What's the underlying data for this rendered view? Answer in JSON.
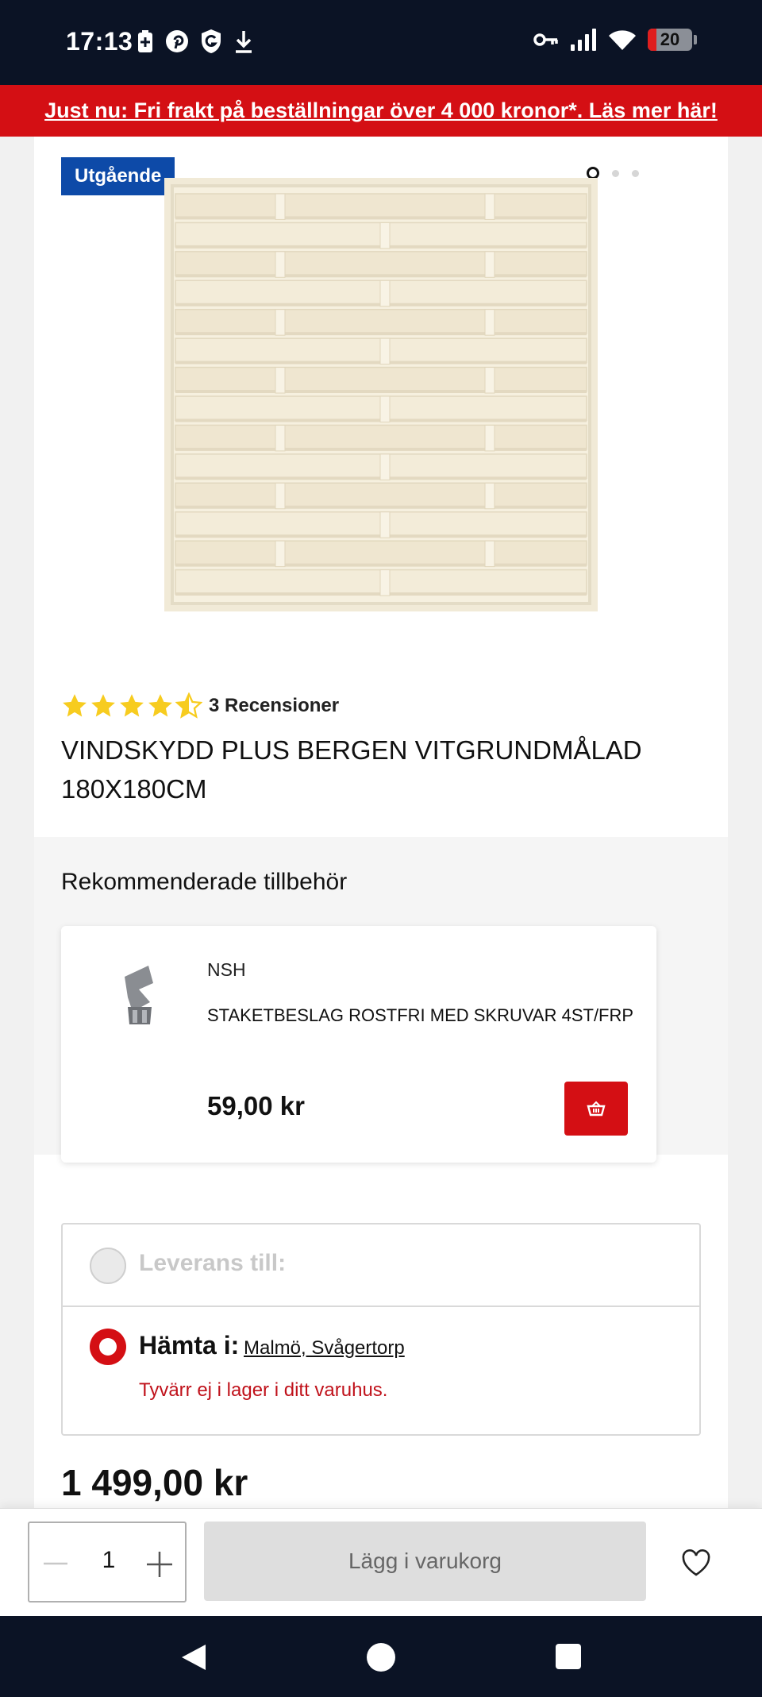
{
  "status_bar": {
    "time": "17:13",
    "left_icons": [
      "battery-saver-icon",
      "pinterest-icon",
      "g-shield-icon",
      "download-icon"
    ],
    "right_icons": [
      "key-icon",
      "signal-icon",
      "wifi-icon"
    ],
    "battery_level": "20"
  },
  "promo_banner": {
    "text": "Just nu: Fri frakt på beställningar över 4 000 kronor*. Läs mer här!"
  },
  "gallery": {
    "badge": "Utgående",
    "slides": 3,
    "active_slide": 1
  },
  "product": {
    "rating": 4.5,
    "reviews_label": "3 Recensioner",
    "title": "VINDSKYDD PLUS BERGEN VITGRUNDMÅLAD 180X180CM",
    "price": "1 499,00 kr"
  },
  "recommended": {
    "heading": "Rekommenderade tillbehör",
    "items": [
      {
        "brand": "NSH",
        "name": "STAKETBESLAG ROSTFRI MED SKRUVAR 4ST/FRP",
        "price": "59,00 kr",
        "cart_icon": "basket-icon"
      }
    ]
  },
  "fulfillment": {
    "delivery_label": "Leverans till:",
    "pickup_label": "Hämta i:",
    "pickup_store": "Malmö, Svågertorp",
    "stock_message": "Tyvärr ej i lager i ditt varuhus.",
    "selected": "pickup"
  },
  "cart_bar": {
    "quantity": "1",
    "add_to_cart_label": "Lägg i varukorg"
  },
  "colors": {
    "brand_red": "#d40f14",
    "badge_blue": "#0d4aa8",
    "star_yellow": "#f7cc1f",
    "system_bar": "#0b1325"
  }
}
